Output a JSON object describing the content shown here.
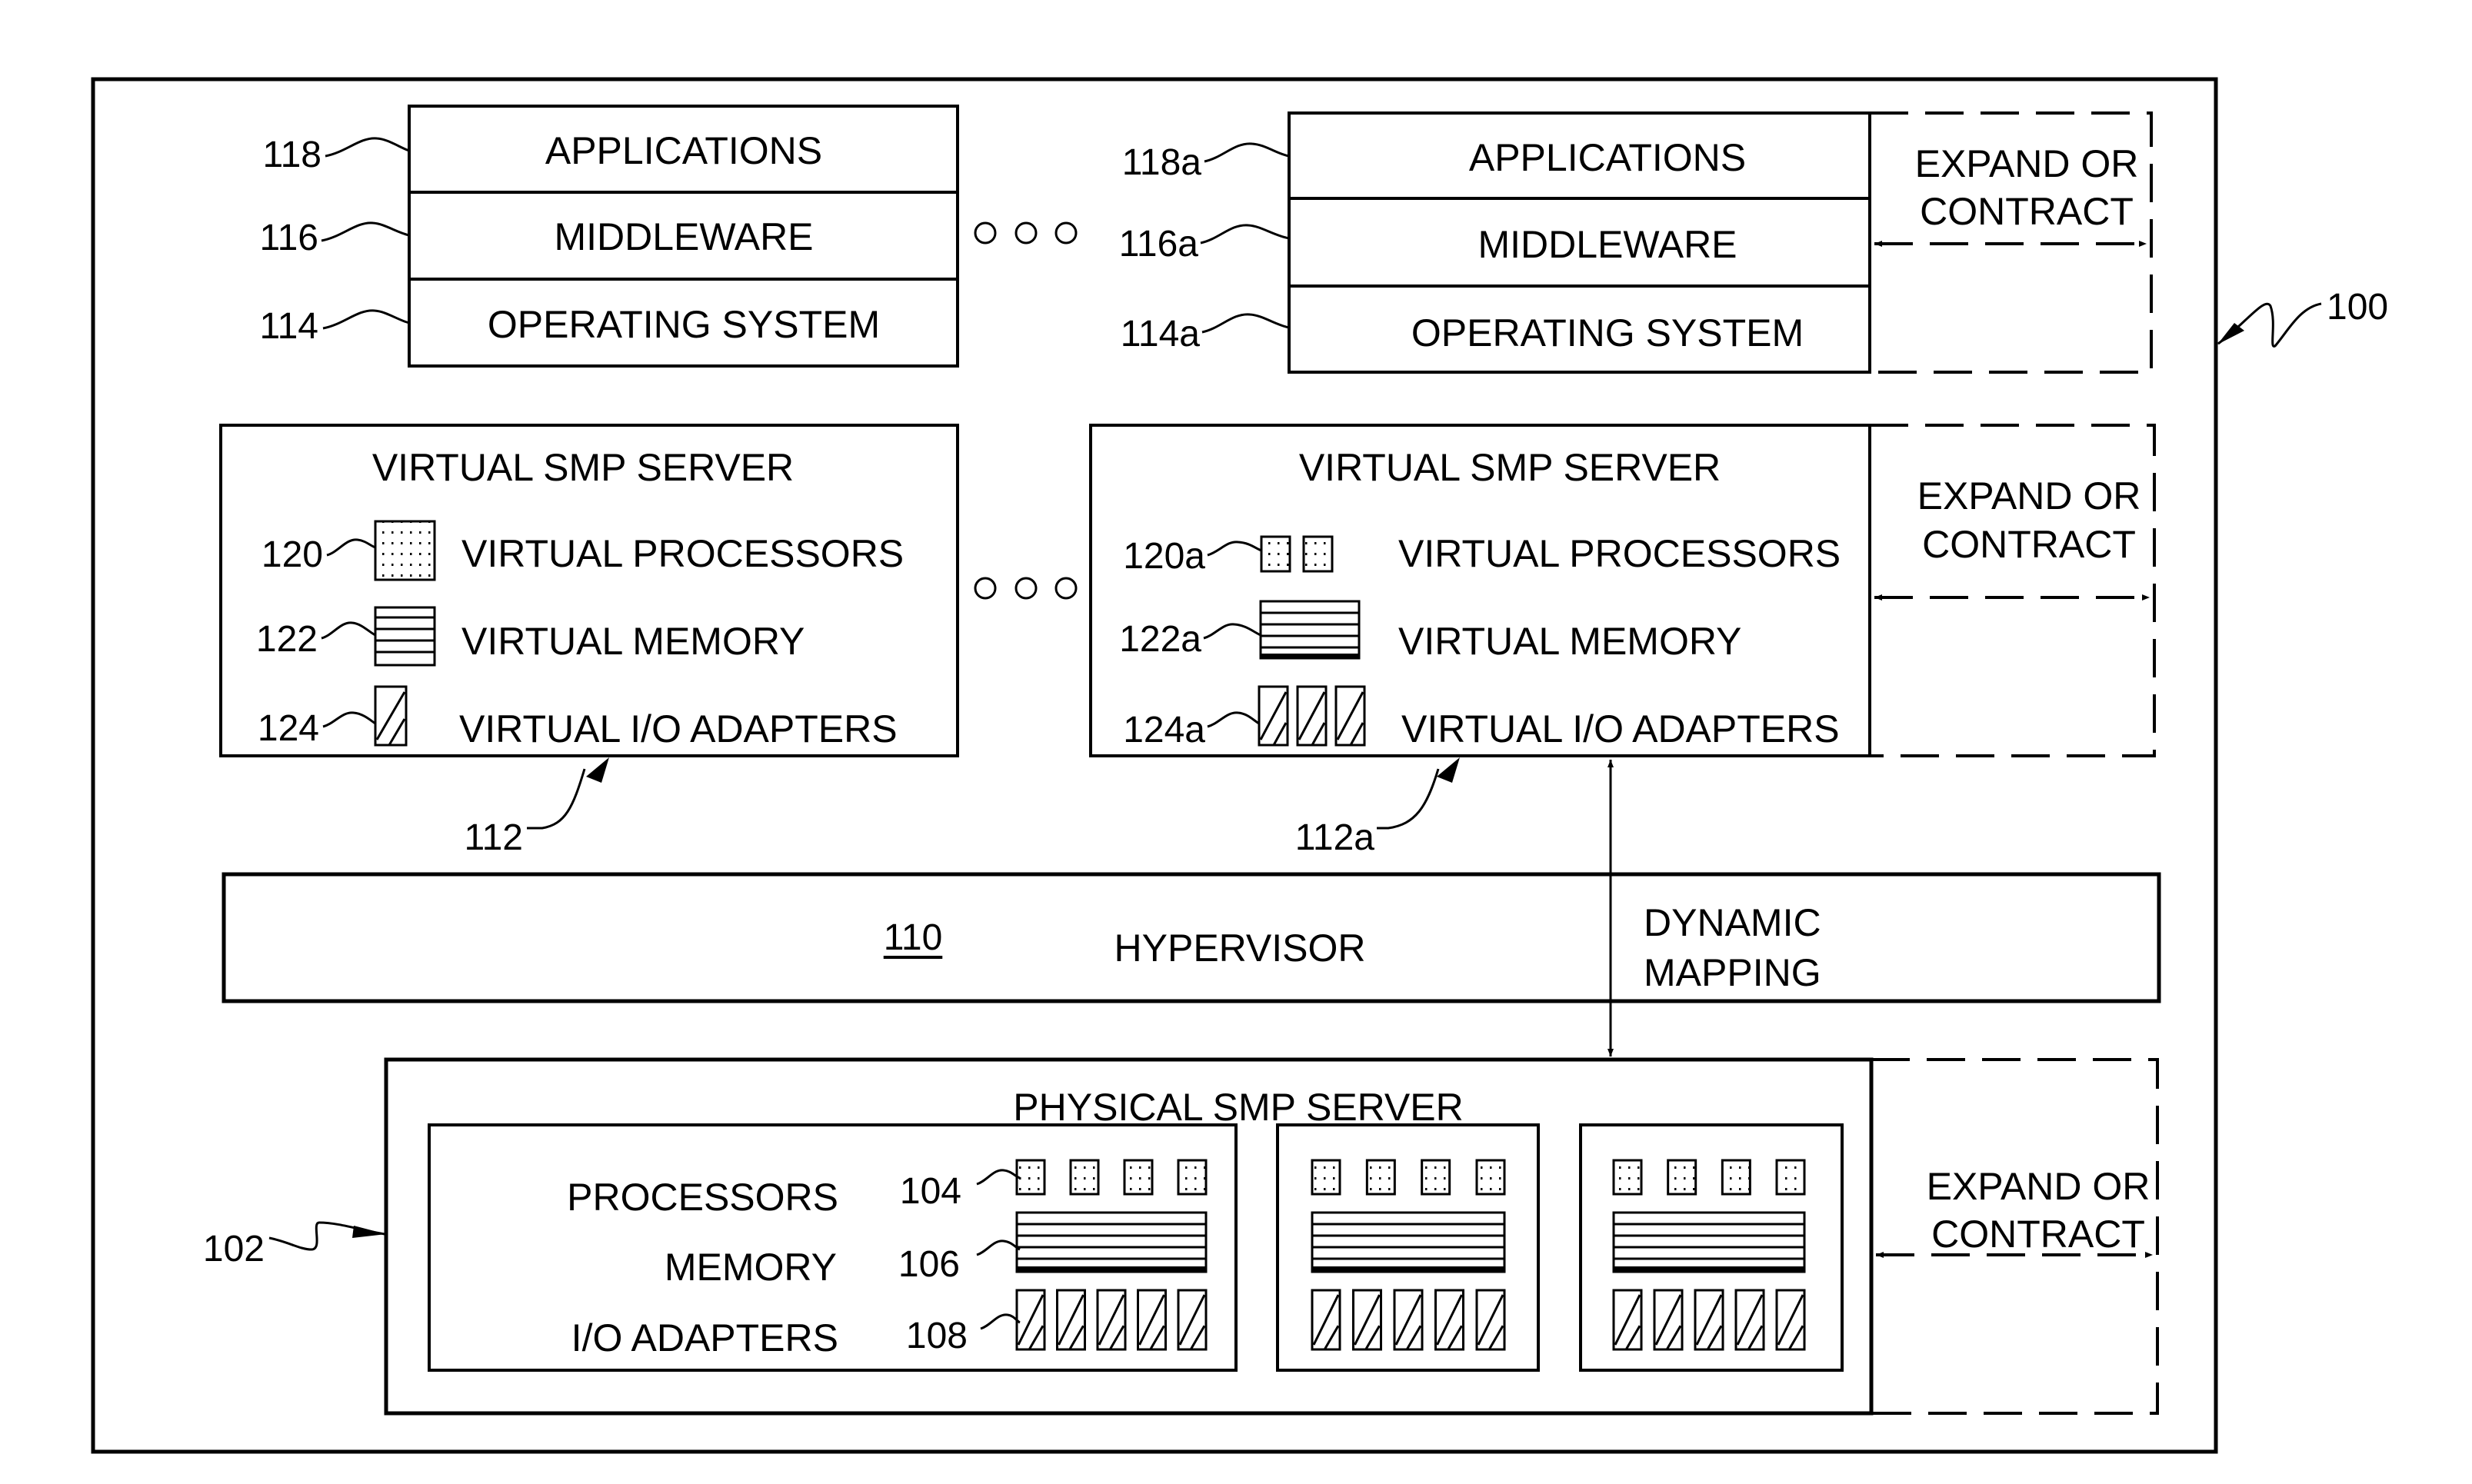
{
  "figure": {
    "system_ref": "100",
    "ellipsis": "ooo"
  },
  "left_stack": {
    "layers": [
      {
        "ref": "118",
        "label": "APPLICATIONS"
      },
      {
        "ref": "116",
        "label": "MIDDLEWARE"
      },
      {
        "ref": "114",
        "label": "OPERATING SYSTEM"
      }
    ]
  },
  "right_stack": {
    "layers": [
      {
        "ref": "118a",
        "label": "APPLICATIONS"
      },
      {
        "ref": "116a",
        "label": "MIDDLEWARE"
      },
      {
        "ref": "114a",
        "label": "OPERATING SYSTEM"
      }
    ],
    "expand_label": [
      "EXPAND OR",
      "CONTRACT"
    ]
  },
  "virtual_server_left": {
    "ref": "112",
    "title": "VIRTUAL SMP SERVER",
    "items": [
      {
        "ref": "120",
        "label": "VIRTUAL PROCESSORS",
        "icon": "dotted-processor-icon",
        "count": 1
      },
      {
        "ref": "122",
        "label": "VIRTUAL MEMORY",
        "icon": "striped-memory-icon",
        "count": 1
      },
      {
        "ref": "124",
        "label": "VIRTUAL I/O ADAPTERS",
        "icon": "hatched-adapter-icon",
        "count": 1
      }
    ]
  },
  "virtual_server_right": {
    "ref": "112a",
    "title": "VIRTUAL SMP SERVER",
    "items": [
      {
        "ref": "120a",
        "label": "VIRTUAL PROCESSORS",
        "icon": "dotted-processor-icon",
        "count": 2
      },
      {
        "ref": "122a",
        "label": "VIRTUAL MEMORY",
        "icon": "striped-memory-icon",
        "count": 1
      },
      {
        "ref": "124a",
        "label": "VIRTUAL I/O ADAPTERS",
        "icon": "hatched-adapter-icon",
        "count": 3
      }
    ],
    "expand_label": [
      "EXPAND OR",
      "CONTRACT"
    ]
  },
  "hypervisor": {
    "ref": "110",
    "label": "HYPERVISOR",
    "mapping_label": [
      "DYNAMIC",
      "MAPPING"
    ]
  },
  "physical_server": {
    "ref": "102",
    "title": "PHYSICAL SMP SERVER",
    "row_labels": [
      {
        "ref": "104",
        "label": "PROCESSORS"
      },
      {
        "ref": "106",
        "label": "MEMORY"
      },
      {
        "ref": "108",
        "label": "I/O ADAPTERS"
      }
    ],
    "nodes": [
      {
        "processors": 4,
        "memory_modules": 1,
        "io_adapters": 5
      },
      {
        "processors": 4,
        "memory_modules": 1,
        "io_adapters": 5
      },
      {
        "processors": 4,
        "memory_modules": 1,
        "io_adapters": 5
      }
    ],
    "expand_label": [
      "EXPAND OR",
      "CONTRACT"
    ]
  }
}
